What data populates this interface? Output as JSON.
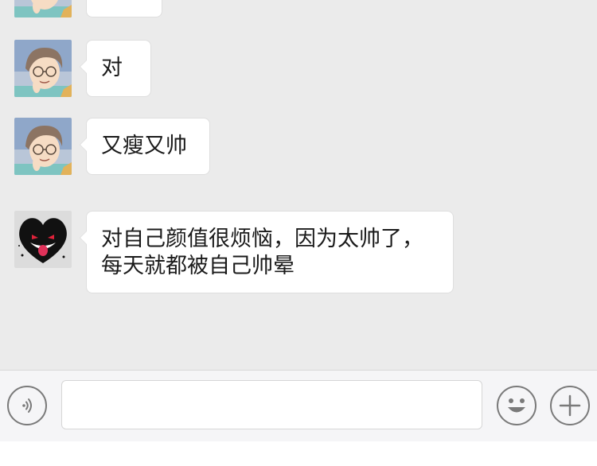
{
  "messages": [
    {
      "avatar": "boy-glasses-avatar",
      "text": ""
    },
    {
      "avatar": "boy-glasses-avatar",
      "text": "对"
    },
    {
      "avatar": "boy-glasses-avatar",
      "text": "又瘦又帅"
    },
    {
      "avatar": "black-heart-monster-avatar",
      "text": "对自己颜值很烦恼，因为太帅了，\n每天就都被自己帅晕"
    }
  ],
  "input_bar": {
    "voice_icon": "voice-icon",
    "message_value": "",
    "emoji_icon": "emoji-icon",
    "add_icon": "plus-icon"
  },
  "colors": {
    "chat_background": "#ebebeb",
    "bubble_background": "#ffffff",
    "input_bar_background": "#f5f5f7",
    "icon_stroke": "#7a7a7a"
  }
}
